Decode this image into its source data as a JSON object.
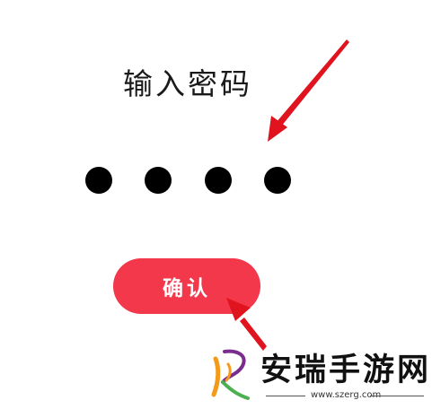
{
  "screen": {
    "title": "输入密码",
    "pin_dots_filled": 4,
    "confirm_label": "确认"
  },
  "watermark": {
    "brand_name": "安瑞手游网",
    "url": "www.szerg.com"
  },
  "colors": {
    "background": "#ffffff",
    "confirm_button": "#f2384a",
    "dot": "#000000",
    "annotation_arrow": "#e0141e",
    "logo_orange": "#f39a1a",
    "logo_purple": "#7b2d8e",
    "logo_green": "#4caf50"
  },
  "icons": {
    "pin_dot": "filled-circle",
    "annotation": "red-arrow"
  }
}
